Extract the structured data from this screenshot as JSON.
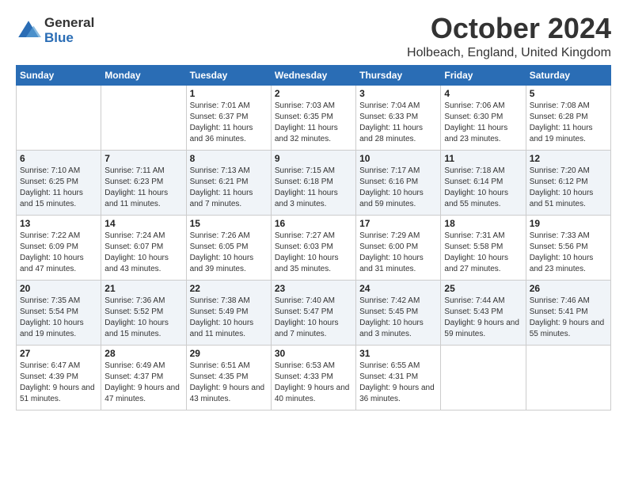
{
  "header": {
    "logo": {
      "general": "General",
      "blue": "Blue"
    },
    "month": "October 2024",
    "location": "Holbeach, England, United Kingdom"
  },
  "weekdays": [
    "Sunday",
    "Monday",
    "Tuesday",
    "Wednesday",
    "Thursday",
    "Friday",
    "Saturday"
  ],
  "weeks": [
    [
      {
        "day": "",
        "sunrise": "",
        "sunset": "",
        "daylight": ""
      },
      {
        "day": "",
        "sunrise": "",
        "sunset": "",
        "daylight": ""
      },
      {
        "day": "1",
        "sunrise": "Sunrise: 7:01 AM",
        "sunset": "Sunset: 6:37 PM",
        "daylight": "Daylight: 11 hours and 36 minutes."
      },
      {
        "day": "2",
        "sunrise": "Sunrise: 7:03 AM",
        "sunset": "Sunset: 6:35 PM",
        "daylight": "Daylight: 11 hours and 32 minutes."
      },
      {
        "day": "3",
        "sunrise": "Sunrise: 7:04 AM",
        "sunset": "Sunset: 6:33 PM",
        "daylight": "Daylight: 11 hours and 28 minutes."
      },
      {
        "day": "4",
        "sunrise": "Sunrise: 7:06 AM",
        "sunset": "Sunset: 6:30 PM",
        "daylight": "Daylight: 11 hours and 23 minutes."
      },
      {
        "day": "5",
        "sunrise": "Sunrise: 7:08 AM",
        "sunset": "Sunset: 6:28 PM",
        "daylight": "Daylight: 11 hours and 19 minutes."
      }
    ],
    [
      {
        "day": "6",
        "sunrise": "Sunrise: 7:10 AM",
        "sunset": "Sunset: 6:25 PM",
        "daylight": "Daylight: 11 hours and 15 minutes."
      },
      {
        "day": "7",
        "sunrise": "Sunrise: 7:11 AM",
        "sunset": "Sunset: 6:23 PM",
        "daylight": "Daylight: 11 hours and 11 minutes."
      },
      {
        "day": "8",
        "sunrise": "Sunrise: 7:13 AM",
        "sunset": "Sunset: 6:21 PM",
        "daylight": "Daylight: 11 hours and 7 minutes."
      },
      {
        "day": "9",
        "sunrise": "Sunrise: 7:15 AM",
        "sunset": "Sunset: 6:18 PM",
        "daylight": "Daylight: 11 hours and 3 minutes."
      },
      {
        "day": "10",
        "sunrise": "Sunrise: 7:17 AM",
        "sunset": "Sunset: 6:16 PM",
        "daylight": "Daylight: 10 hours and 59 minutes."
      },
      {
        "day": "11",
        "sunrise": "Sunrise: 7:18 AM",
        "sunset": "Sunset: 6:14 PM",
        "daylight": "Daylight: 10 hours and 55 minutes."
      },
      {
        "day": "12",
        "sunrise": "Sunrise: 7:20 AM",
        "sunset": "Sunset: 6:12 PM",
        "daylight": "Daylight: 10 hours and 51 minutes."
      }
    ],
    [
      {
        "day": "13",
        "sunrise": "Sunrise: 7:22 AM",
        "sunset": "Sunset: 6:09 PM",
        "daylight": "Daylight: 10 hours and 47 minutes."
      },
      {
        "day": "14",
        "sunrise": "Sunrise: 7:24 AM",
        "sunset": "Sunset: 6:07 PM",
        "daylight": "Daylight: 10 hours and 43 minutes."
      },
      {
        "day": "15",
        "sunrise": "Sunrise: 7:26 AM",
        "sunset": "Sunset: 6:05 PM",
        "daylight": "Daylight: 10 hours and 39 minutes."
      },
      {
        "day": "16",
        "sunrise": "Sunrise: 7:27 AM",
        "sunset": "Sunset: 6:03 PM",
        "daylight": "Daylight: 10 hours and 35 minutes."
      },
      {
        "day": "17",
        "sunrise": "Sunrise: 7:29 AM",
        "sunset": "Sunset: 6:00 PM",
        "daylight": "Daylight: 10 hours and 31 minutes."
      },
      {
        "day": "18",
        "sunrise": "Sunrise: 7:31 AM",
        "sunset": "Sunset: 5:58 PM",
        "daylight": "Daylight: 10 hours and 27 minutes."
      },
      {
        "day": "19",
        "sunrise": "Sunrise: 7:33 AM",
        "sunset": "Sunset: 5:56 PM",
        "daylight": "Daylight: 10 hours and 23 minutes."
      }
    ],
    [
      {
        "day": "20",
        "sunrise": "Sunrise: 7:35 AM",
        "sunset": "Sunset: 5:54 PM",
        "daylight": "Daylight: 10 hours and 19 minutes."
      },
      {
        "day": "21",
        "sunrise": "Sunrise: 7:36 AM",
        "sunset": "Sunset: 5:52 PM",
        "daylight": "Daylight: 10 hours and 15 minutes."
      },
      {
        "day": "22",
        "sunrise": "Sunrise: 7:38 AM",
        "sunset": "Sunset: 5:49 PM",
        "daylight": "Daylight: 10 hours and 11 minutes."
      },
      {
        "day": "23",
        "sunrise": "Sunrise: 7:40 AM",
        "sunset": "Sunset: 5:47 PM",
        "daylight": "Daylight: 10 hours and 7 minutes."
      },
      {
        "day": "24",
        "sunrise": "Sunrise: 7:42 AM",
        "sunset": "Sunset: 5:45 PM",
        "daylight": "Daylight: 10 hours and 3 minutes."
      },
      {
        "day": "25",
        "sunrise": "Sunrise: 7:44 AM",
        "sunset": "Sunset: 5:43 PM",
        "daylight": "Daylight: 9 hours and 59 minutes."
      },
      {
        "day": "26",
        "sunrise": "Sunrise: 7:46 AM",
        "sunset": "Sunset: 5:41 PM",
        "daylight": "Daylight: 9 hours and 55 minutes."
      }
    ],
    [
      {
        "day": "27",
        "sunrise": "Sunrise: 6:47 AM",
        "sunset": "Sunset: 4:39 PM",
        "daylight": "Daylight: 9 hours and 51 minutes."
      },
      {
        "day": "28",
        "sunrise": "Sunrise: 6:49 AM",
        "sunset": "Sunset: 4:37 PM",
        "daylight": "Daylight: 9 hours and 47 minutes."
      },
      {
        "day": "29",
        "sunrise": "Sunrise: 6:51 AM",
        "sunset": "Sunset: 4:35 PM",
        "daylight": "Daylight: 9 hours and 43 minutes."
      },
      {
        "day": "30",
        "sunrise": "Sunrise: 6:53 AM",
        "sunset": "Sunset: 4:33 PM",
        "daylight": "Daylight: 9 hours and 40 minutes."
      },
      {
        "day": "31",
        "sunrise": "Sunrise: 6:55 AM",
        "sunset": "Sunset: 4:31 PM",
        "daylight": "Daylight: 9 hours and 36 minutes."
      },
      {
        "day": "",
        "sunrise": "",
        "sunset": "",
        "daylight": ""
      },
      {
        "day": "",
        "sunrise": "",
        "sunset": "",
        "daylight": ""
      }
    ]
  ]
}
